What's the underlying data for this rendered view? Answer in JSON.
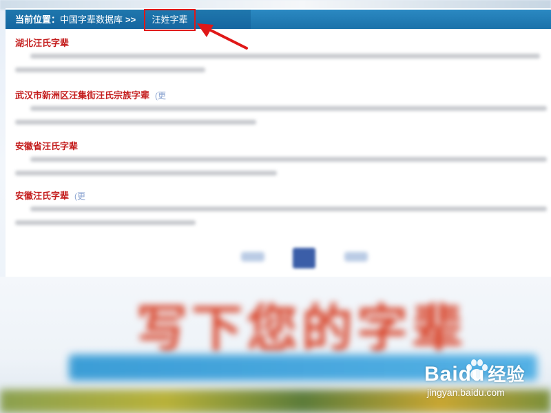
{
  "breadcrumb": {
    "label": "当前位置：",
    "root": "中国字辈数据库",
    "separator": ">>",
    "current": "汪姓字辈"
  },
  "results": [
    {
      "title": "湖北汪氏字辈"
    },
    {
      "title": "武汉市新洲区汪集街汪氏宗族字辈",
      "more_label": "(更"
    },
    {
      "title": "安徽省汪氏字辈"
    },
    {
      "title": "安徽汪氏字辈",
      "more_label": "(更"
    }
  ],
  "banner": {
    "headline": "写下您的字辈"
  },
  "watermark": {
    "logo_text": "Baidu",
    "logo_cn": "经验",
    "url": "jingyan.baidu.com"
  },
  "colors": {
    "bar_blue": "#1566a0",
    "title_red": "#c41d1d",
    "highlight_red": "#e01818"
  }
}
